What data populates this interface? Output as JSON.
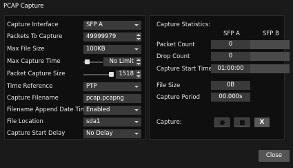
{
  "window": {
    "title": "PCAP Capture"
  },
  "settings": {
    "capture_interface": {
      "label": "Capture Interface",
      "value": "SFP A"
    },
    "packets_to_capture": {
      "label": "Packets To Capture",
      "value": "49999979"
    },
    "max_file_size": {
      "label": "Max File Size",
      "value": "100KB"
    },
    "max_capture_time": {
      "label": "Max Capture Time",
      "value": "No Limit",
      "slider_level": 0.0
    },
    "packet_capture_size": {
      "label": "Packet Capture Size",
      "value": "1518",
      "slider_level": 1.0
    },
    "time_reference": {
      "label": "Time Reference",
      "value": "PTP"
    },
    "capture_filename": {
      "label": "Capture Filename",
      "value": "pcap.pcapng"
    },
    "filename_append": {
      "label": "Filename Append Date Time",
      "value": "Enabled"
    },
    "file_location": {
      "label": "File Location",
      "value": "sda1"
    },
    "capture_start_delay": {
      "label": "Capture Start Delay",
      "value": "No Delay"
    }
  },
  "statistics": {
    "heading": "Capture Statistics:",
    "columns": [
      "SFP A",
      "SFP B"
    ],
    "packet_count": {
      "label": "Packet Count",
      "sfp_a": "0",
      "sfp_b": ""
    },
    "drop_count": {
      "label": "Drop Count",
      "sfp_a": "0",
      "sfp_b": ""
    },
    "capture_start_time": {
      "label": "Capture Start Time",
      "sfp_a": "01:00:00",
      "sfp_b": ""
    },
    "file_size": {
      "label": "File Size",
      "value": "0B"
    },
    "capture_period": {
      "label": "Capture Period",
      "value": "00.000s"
    }
  },
  "capture": {
    "label": "Capture:",
    "record_icon": "record-icon",
    "stop_icon": "stop-icon",
    "clear_label": "X"
  },
  "footer": {
    "close_label": "Close"
  },
  "colors": {
    "background": "#1a1a1a",
    "panel": "#0f0f0f",
    "control": "#3a3a3a",
    "text": "#e8e8e8"
  }
}
